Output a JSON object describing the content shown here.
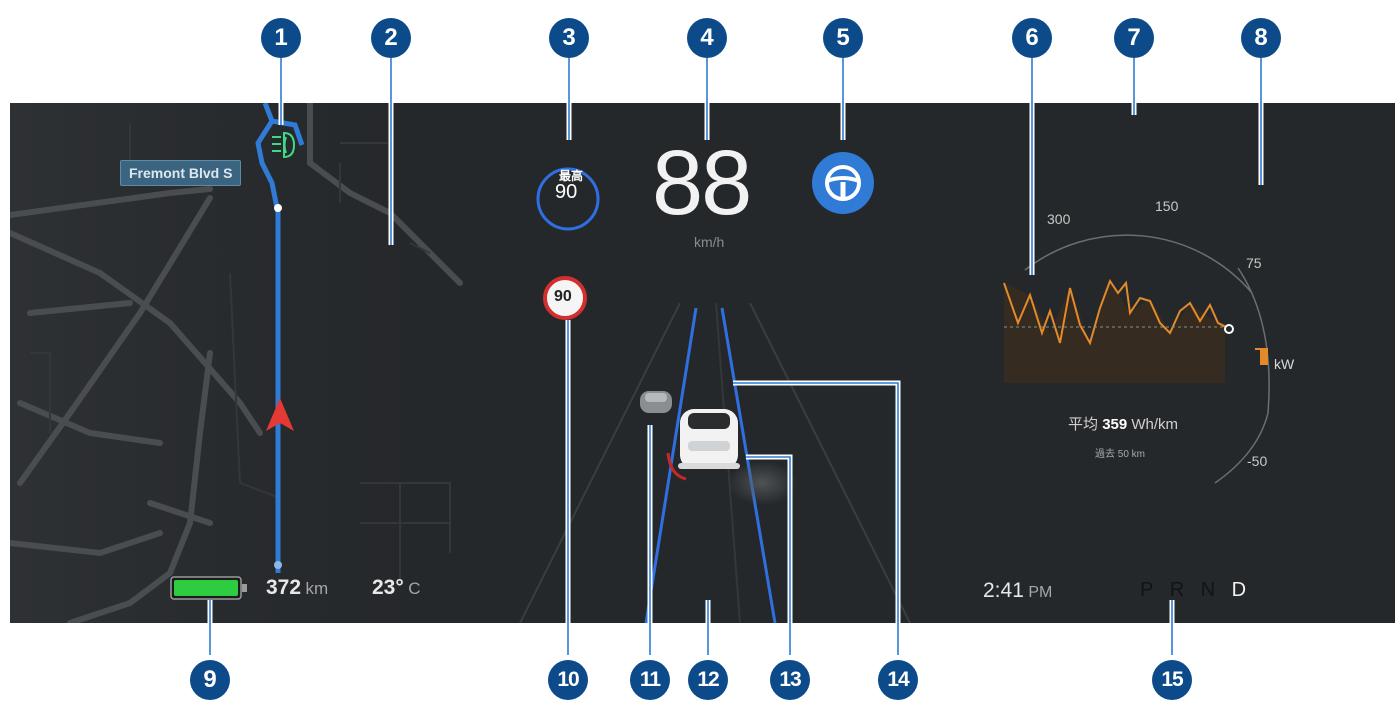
{
  "map": {
    "street_label": "Fremont Blvd S",
    "fog_light_icon": "front-fog-light-icon",
    "nav_arrow_icon": "navigation-arrow-icon"
  },
  "cluster": {
    "max_speed_label": "最高",
    "max_speed_value": "90",
    "speed_value": "88",
    "speed_unit": "km/h",
    "autosteer_icon": "steering-wheel-icon",
    "speed_sign_value": "90"
  },
  "energy": {
    "scale_labels": [
      "300",
      "150",
      "75",
      "-50"
    ],
    "unit": "kW",
    "avg_prefix": "平均",
    "avg_value": "359",
    "avg_unit": "Wh/km",
    "distance_note": "過去 50 km"
  },
  "status": {
    "battery_level": 1.0,
    "range_value": "372",
    "range_unit": "km",
    "temp_value": "23°",
    "temp_unit": "C",
    "time_value": "2:41",
    "time_ampm": "PM",
    "gears": [
      "P",
      "R",
      "N",
      "D"
    ],
    "active_gear": "D"
  },
  "callouts": [
    "1",
    "2",
    "3",
    "4",
    "5",
    "6",
    "7",
    "8",
    "9",
    "10",
    "11",
    "12",
    "13",
    "14",
    "15"
  ],
  "colors": {
    "panel_bg": "#25282b",
    "route_blue": "#2f7bd6",
    "lane_blue": "#2f6fe0",
    "badge_blue": "#0c4a8a",
    "battery_green": "#2ecc40",
    "energy_orange": "#e38a2a",
    "fog_light_green": "#3ddc84",
    "nav_arrow_red": "#e53935"
  }
}
